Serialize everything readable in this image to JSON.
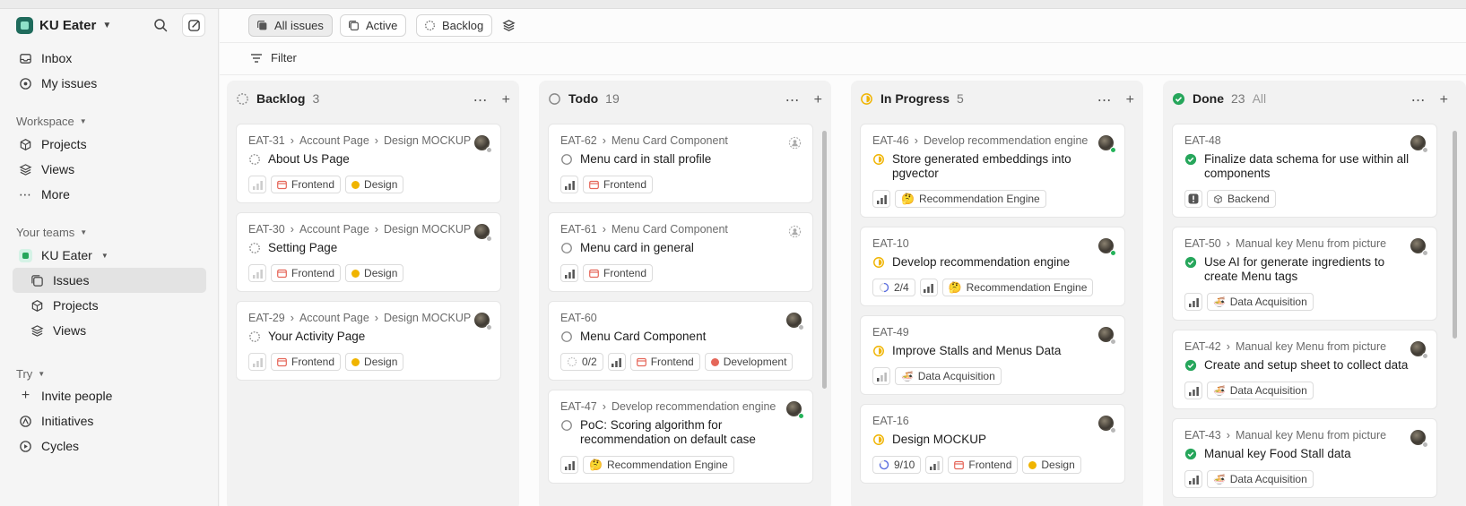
{
  "workspace": {
    "name": "KU Eater"
  },
  "sidebar": {
    "inbox": "Inbox",
    "my_issues": "My issues",
    "workspace_label": "Workspace",
    "projects": "Projects",
    "views": "Views",
    "more": "More",
    "your_teams_label": "Your teams",
    "team_name": "KU Eater",
    "team_issues": "Issues",
    "team_projects": "Projects",
    "team_views": "Views",
    "try_label": "Try",
    "invite": "Invite people",
    "initiatives": "Initiatives",
    "cycles": "Cycles"
  },
  "toolbar": {
    "all_issues": "All issues",
    "active": "Active",
    "backlog": "Backlog"
  },
  "filter": {
    "label": "Filter"
  },
  "columns": {
    "backlog": {
      "title": "Backlog",
      "count": "3"
    },
    "todo": {
      "title": "Todo",
      "count": "19"
    },
    "inprogress": {
      "title": "In Progress",
      "count": "5"
    },
    "done": {
      "title": "Done",
      "count": "23",
      "all": "All"
    }
  },
  "cards": {
    "b1": {
      "id": "EAT-31",
      "parent": "Account Page",
      "sub": "Design MOCKUP",
      "title": "About Us Page",
      "labels": [
        "Frontend",
        "Design"
      ]
    },
    "b2": {
      "id": "EAT-30",
      "parent": "Account Page",
      "sub": "Design MOCKUP",
      "title": "Setting Page",
      "labels": [
        "Frontend",
        "Design"
      ]
    },
    "b3": {
      "id": "EAT-29",
      "parent": "Account Page",
      "sub": "Design MOCKUP",
      "title": "Your Activity Page",
      "labels": [
        "Frontend",
        "Design"
      ]
    },
    "t1": {
      "id": "EAT-62",
      "parent": "Menu Card Component",
      "title": "Menu card in stall profile",
      "labels": [
        "Frontend"
      ]
    },
    "t2": {
      "id": "EAT-61",
      "parent": "Menu Card Component",
      "title": "Menu card in general",
      "labels": [
        "Frontend"
      ]
    },
    "t3": {
      "id": "EAT-60",
      "title": "Menu Card Component",
      "progress": "0/2",
      "labels": [
        "Frontend",
        "Development"
      ]
    },
    "t4": {
      "id": "EAT-47",
      "parent": "Develop recommendation engine",
      "title": "PoC: Scoring algorithm for recommendation on default case",
      "labels": [
        "Recommendation Engine"
      ]
    },
    "p1": {
      "id": "EAT-46",
      "parent": "Develop recommendation engine",
      "title": "Store generated embeddings into pgvector",
      "labels": [
        "Recommendation Engine"
      ]
    },
    "p2": {
      "id": "EAT-10",
      "title": "Develop recommendation engine",
      "progress": "2/4",
      "labels": [
        "Recommendation Engine"
      ]
    },
    "p3": {
      "id": "EAT-49",
      "title": "Improve Stalls and Menus Data",
      "labels": [
        "Data Acquisition"
      ]
    },
    "p4": {
      "id": "EAT-16",
      "title": "Design MOCKUP",
      "progress": "9/10",
      "labels": [
        "Frontend",
        "Design"
      ]
    },
    "d1": {
      "id": "EAT-48",
      "title": "Finalize data schema for use within all components",
      "labels": [
        "Backend"
      ]
    },
    "d2": {
      "id": "EAT-50",
      "parent": "Manual key Menu from picture",
      "title": "Use AI for generate ingredients to create Menu tags",
      "labels": [
        "Data Acquisition"
      ]
    },
    "d3": {
      "id": "EAT-42",
      "parent": "Manual key Menu from picture",
      "title": "Create and setup sheet to collect data",
      "labels": [
        "Data Acquisition"
      ]
    },
    "d4": {
      "id": "EAT-43",
      "parent": "Manual key Menu from picture",
      "title": "Manual key Food Stall data",
      "labels": [
        "Data Acquisition"
      ]
    }
  },
  "colors": {
    "accent": "#1f6b5c",
    "frontend": "#e5675a",
    "design": "#f0b400",
    "development": "#e5675a",
    "inprogress": "#f0b400",
    "done": "#26a65b"
  }
}
